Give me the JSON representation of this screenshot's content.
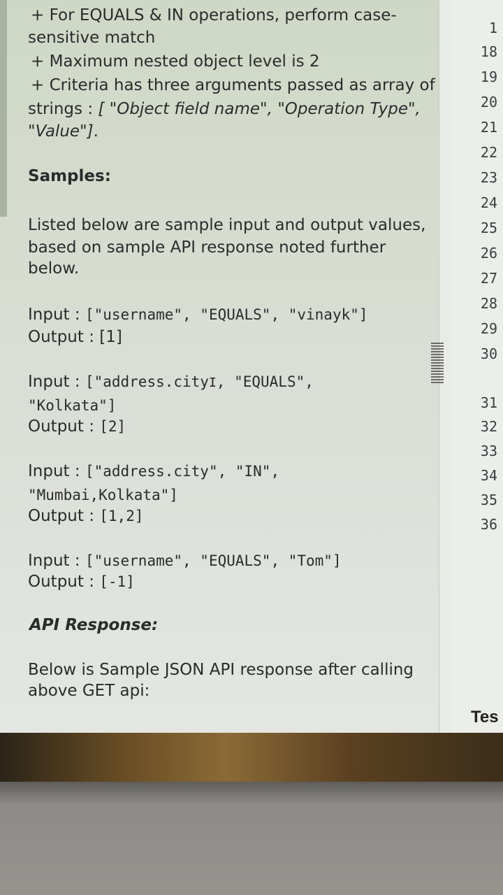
{
  "problem": {
    "rule_equals_in": "+ For EQUALS & IN operations, perform case-",
    "rule_equals_in_cont": "sensitive match",
    "rule_nested": "+ Maximum nested object level is 2",
    "rule_criteria": "+ Criteria has three arguments passed as array of",
    "rule_criteria_prefix": "strings : ",
    "rule_criteria_arr1": "[ \"Object field name\", \"Operation Type\",",
    "rule_criteria_arr2": "\"Value\"]",
    "rule_criteria_end": ".",
    "samples_heading": "Samples:",
    "samples_intro_1": "Listed below are sample input and output values,",
    "samples_intro_2": "based on sample API response noted further",
    "samples_intro_3": "below.",
    "sample1_input_label": "Input : ",
    "sample1_input_value": "[\"username\", \"EQUALS\", \"vinayk\"]",
    "sample1_output_label": "Output : ",
    "sample1_output_value": "[1]",
    "sample2_input_label": "Input : ",
    "sample2_input_value": "[\"address.city",
    "sample2_input_value_b": ", \"EQUALS\",",
    "sample2_input_value_2": "\"Kolkata\"]",
    "sample2_output_label": "Output : ",
    "sample2_output_value": "[2]",
    "sample3_input_label": "Input : ",
    "sample3_input_value": "[\"address.city\", \"IN\",",
    "sample3_input_value_2": "\"Mumbai,Kolkata\"]",
    "sample3_output_label": "Output : ",
    "sample3_output_value": "[1,2]",
    "sample4_input_label": "Input : ",
    "sample4_input_value": "[\"username\", \"EQUALS\", \"Tom\"]",
    "sample4_output_label": "Output : ",
    "sample4_output_value": "[-1]",
    "api_heading": "API Response:",
    "api_desc_1": "Below is Sample JSON API response after calling",
    "api_desc_2": "above GET api:"
  },
  "editor": {
    "line_numbers": [
      "1",
      "18",
      "19",
      "20",
      "21",
      "22",
      "23",
      "24",
      "25",
      "26",
      "27",
      "28",
      "29",
      "30",
      "31",
      "32",
      "33",
      "34",
      "35",
      "36"
    ],
    "test_label": "Tes"
  },
  "icons": {
    "text_cursor": "text-cursor-icon",
    "drag_handle": "drag-handle-icon"
  }
}
